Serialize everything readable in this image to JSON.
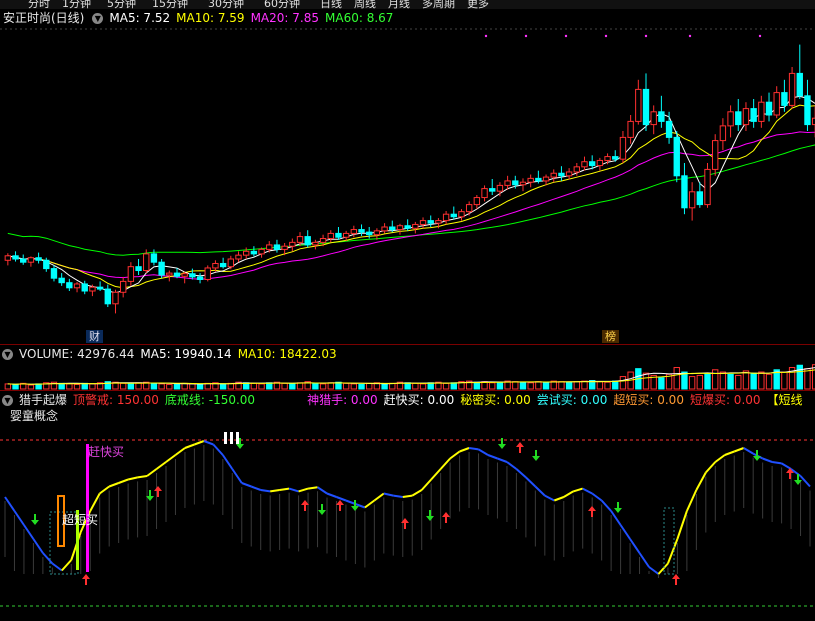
{
  "topbar": {
    "items": [
      "分时",
      "1分钟",
      "5分钟",
      "15分钟",
      "30分钟",
      "60分钟",
      "日线",
      "周线",
      "月线",
      "多周期",
      "更多"
    ]
  },
  "main_header": {
    "title": "安正时尚(日线)",
    "ma5": "MA5: 7.52",
    "ma10": "MA10: 7.59",
    "ma20": "MA20: 7.85",
    "ma60": "MA60: 8.67"
  },
  "main_markers": {
    "cai": "财",
    "bang": "榜"
  },
  "volume_header": {
    "title": "VOLUME: 42976.44",
    "ma5": "MA5: 19940.14",
    "ma10": "MA10: 18422.03"
  },
  "indicator_header": {
    "name": "猎手起爆",
    "top_warn": "顶警戒: 150.00",
    "bottom_warn": "底戒线: -150.00",
    "hunter": "神猎手: 0.00",
    "quick_buy": "赶快买: 0.00",
    "secret_buy": "秘密买: 0.00",
    "try_buy": "尝试买: 0.00",
    "super_short": "超短买: 0.00",
    "short_burst": "短爆买: 0.00",
    "short_line": "【短线"
  },
  "indicator_sub": "婴童概念",
  "indicator_labels": {
    "quick_buy": "赶快买",
    "super_short": "超短买"
  },
  "colors": {
    "ma5": "#ffffff",
    "ma10": "#ffff00",
    "ma20": "#ff00ff",
    "ma60": "#00ff00",
    "up": "#ff3030",
    "down": "#00ffff",
    "curve_up": "#ffff00",
    "curve_down": "#2050ff"
  },
  "chart_data": [
    {
      "type": "candlestick",
      "title": "安正时尚(日线)",
      "ma_series": [
        {
          "name": "MA5",
          "value": 7.52
        },
        {
          "name": "MA10",
          "value": 7.59
        },
        {
          "name": "MA20",
          "value": 7.85
        },
        {
          "name": "MA60",
          "value": 8.67
        }
      ],
      "ohlc": [
        [
          7.38,
          7.49,
          7.3,
          7.45
        ],
        [
          7.45,
          7.52,
          7.36,
          7.4
        ],
        [
          7.4,
          7.47,
          7.31,
          7.35
        ],
        [
          7.35,
          7.44,
          7.28,
          7.42
        ],
        [
          7.42,
          7.5,
          7.33,
          7.38
        ],
        [
          7.38,
          7.42,
          7.2,
          7.25
        ],
        [
          7.25,
          7.3,
          7.05,
          7.1
        ],
        [
          7.1,
          7.18,
          6.98,
          7.03
        ],
        [
          7.03,
          7.09,
          6.9,
          6.95
        ],
        [
          6.95,
          7.04,
          6.88,
          7.01
        ],
        [
          7.01,
          7.06,
          6.85,
          6.9
        ],
        [
          6.9,
          7.0,
          6.82,
          6.96
        ],
        [
          6.96,
          7.05,
          6.9,
          6.93
        ],
        [
          6.93,
          7.0,
          6.65,
          6.7
        ],
        [
          6.7,
          6.92,
          6.55,
          6.88
        ],
        [
          6.88,
          7.12,
          6.8,
          7.05
        ],
        [
          7.05,
          7.35,
          6.98,
          7.28
        ],
        [
          7.28,
          7.4,
          7.15,
          7.22
        ],
        [
          7.22,
          7.55,
          7.18,
          7.48
        ],
        [
          7.48,
          7.55,
          7.3,
          7.35
        ],
        [
          7.35,
          7.4,
          7.1,
          7.15
        ],
        [
          7.15,
          7.22,
          7.05,
          7.18
        ],
        [
          7.18,
          7.26,
          7.1,
          7.13
        ],
        [
          7.13,
          7.2,
          7.02,
          7.17
        ],
        [
          7.17,
          7.25,
          7.08,
          7.12
        ],
        [
          7.12,
          7.18,
          7.02,
          7.08
        ],
        [
          7.08,
          7.3,
          7.05,
          7.26
        ],
        [
          7.26,
          7.38,
          7.2,
          7.33
        ],
        [
          7.33,
          7.42,
          7.25,
          7.28
        ],
        [
          7.28,
          7.45,
          7.24,
          7.4
        ],
        [
          7.4,
          7.52,
          7.35,
          7.46
        ],
        [
          7.46,
          7.58,
          7.4,
          7.52
        ],
        [
          7.52,
          7.6,
          7.44,
          7.48
        ],
        [
          7.48,
          7.58,
          7.42,
          7.55
        ],
        [
          7.55,
          7.68,
          7.5,
          7.62
        ],
        [
          7.62,
          7.7,
          7.5,
          7.55
        ],
        [
          7.55,
          7.65,
          7.46,
          7.6
        ],
        [
          7.6,
          7.72,
          7.52,
          7.66
        ],
        [
          7.66,
          7.82,
          7.6,
          7.75
        ],
        [
          7.75,
          7.85,
          7.58,
          7.62
        ],
        [
          7.62,
          7.7,
          7.55,
          7.66
        ],
        [
          7.66,
          7.78,
          7.6,
          7.72
        ],
        [
          7.72,
          7.85,
          7.66,
          7.8
        ],
        [
          7.8,
          7.9,
          7.7,
          7.74
        ],
        [
          7.74,
          7.84,
          7.68,
          7.8
        ],
        [
          7.8,
          7.92,
          7.74,
          7.86
        ],
        [
          7.86,
          7.94,
          7.76,
          7.82
        ],
        [
          7.82,
          7.9,
          7.72,
          7.78
        ],
        [
          7.78,
          7.88,
          7.7,
          7.84
        ],
        [
          7.84,
          7.96,
          7.8,
          7.9
        ],
        [
          7.9,
          8.0,
          7.82,
          7.86
        ],
        [
          7.86,
          7.95,
          7.78,
          7.92
        ],
        [
          7.92,
          8.02,
          7.84,
          7.88
        ],
        [
          7.88,
          7.98,
          7.8,
          7.94
        ],
        [
          7.94,
          8.05,
          7.88,
          8.0
        ],
        [
          8.0,
          8.08,
          7.9,
          7.96
        ],
        [
          7.96,
          8.04,
          7.88,
          8.0
        ],
        [
          8.0,
          8.15,
          7.94,
          8.1
        ],
        [
          8.1,
          8.22,
          8.02,
          8.06
        ],
        [
          8.06,
          8.18,
          8.0,
          8.14
        ],
        [
          8.14,
          8.3,
          8.08,
          8.25
        ],
        [
          8.25,
          8.4,
          8.18,
          8.36
        ],
        [
          8.36,
          8.55,
          8.3,
          8.5
        ],
        [
          8.5,
          8.65,
          8.4,
          8.46
        ],
        [
          8.46,
          8.6,
          8.38,
          8.55
        ],
        [
          8.55,
          8.7,
          8.48,
          8.62
        ],
        [
          8.62,
          8.7,
          8.5,
          8.56
        ],
        [
          8.56,
          8.66,
          8.46,
          8.6
        ],
        [
          8.6,
          8.72,
          8.52,
          8.66
        ],
        [
          8.66,
          8.78,
          8.58,
          8.62
        ],
        [
          8.62,
          8.72,
          8.55,
          8.68
        ],
        [
          8.68,
          8.8,
          8.6,
          8.74
        ],
        [
          8.74,
          8.85,
          8.62,
          8.7
        ],
        [
          8.7,
          8.82,
          8.64,
          8.76
        ],
        [
          8.76,
          8.9,
          8.7,
          8.84
        ],
        [
          8.84,
          9.0,
          8.78,
          8.92
        ],
        [
          8.92,
          9.02,
          8.8,
          8.86
        ],
        [
          8.86,
          8.98,
          8.78,
          8.94
        ],
        [
          8.94,
          9.05,
          8.88,
          9.0
        ],
        [
          9.0,
          9.1,
          8.92,
          8.96
        ],
        [
          8.96,
          9.4,
          8.9,
          9.3
        ],
        [
          9.3,
          9.65,
          9.2,
          9.55
        ],
        [
          9.55,
          10.2,
          9.5,
          10.05
        ],
        [
          10.05,
          10.3,
          9.4,
          9.5
        ],
        [
          9.5,
          9.8,
          9.35,
          9.7
        ],
        [
          9.7,
          9.95,
          9.45,
          9.55
        ],
        [
          9.55,
          9.7,
          9.2,
          9.3
        ],
        [
          9.3,
          9.4,
          8.6,
          8.7
        ],
        [
          8.7,
          8.9,
          8.1,
          8.2
        ],
        [
          8.2,
          8.6,
          8.0,
          8.45
        ],
        [
          8.45,
          8.6,
          8.2,
          8.25
        ],
        [
          8.25,
          8.9,
          8.2,
          8.8
        ],
        [
          8.8,
          9.35,
          8.7,
          9.25
        ],
        [
          9.25,
          9.6,
          9.1,
          9.48
        ],
        [
          9.48,
          9.8,
          9.3,
          9.7
        ],
        [
          9.7,
          9.9,
          9.4,
          9.5
        ],
        [
          9.5,
          9.85,
          9.4,
          9.75
        ],
        [
          9.75,
          9.9,
          9.45,
          9.55
        ],
        [
          9.55,
          9.95,
          9.45,
          9.85
        ],
        [
          9.85,
          10.0,
          9.55,
          9.65
        ],
        [
          9.65,
          10.1,
          9.6,
          10.0
        ],
        [
          10.0,
          10.2,
          9.7,
          9.8
        ],
        [
          9.8,
          10.4,
          9.75,
          10.3
        ],
        [
          10.3,
          10.75,
          9.9,
          9.95
        ],
        [
          9.95,
          10.2,
          9.4,
          9.5
        ],
        [
          9.5,
          9.8,
          9.3,
          9.6
        ]
      ]
    },
    {
      "type": "bar",
      "title": "VOLUME: 42976.44",
      "series": [
        {
          "name": "VOLUME",
          "value": 42976.44
        },
        {
          "name": "MA5",
          "value": 19940.14
        },
        {
          "name": "MA10",
          "value": 18422.03
        }
      ],
      "values": [
        9,
        8,
        10,
        7,
        9,
        11,
        12,
        10,
        9,
        8,
        10,
        9,
        11,
        13,
        12,
        10,
        9,
        11,
        12,
        10,
        9,
        8,
        9,
        10,
        9,
        8,
        10,
        11,
        9,
        10,
        12,
        11,
        10,
        9,
        11,
        12,
        10,
        9,
        11,
        13,
        10,
        9,
        11,
        12,
        10,
        9,
        8,
        10,
        11,
        9,
        10,
        12,
        11,
        10,
        9,
        11,
        12,
        10,
        11,
        13,
        14,
        12,
        13,
        11,
        12,
        14,
        13,
        12,
        11,
        13,
        12,
        14,
        13,
        12,
        13,
        14,
        15,
        13,
        12,
        14,
        22,
        30,
        36,
        28,
        24,
        20,
        26,
        38,
        30,
        22,
        24,
        28,
        34,
        30,
        26,
        24,
        32,
        28,
        30,
        26,
        34,
        30,
        38,
        42,
        36,
        43
      ]
    },
    {
      "type": "line",
      "title": "猎手起爆",
      "series": [
        {
          "name": "顶警戒",
          "value": 150.0
        },
        {
          "name": "底戒线",
          "value": -150.0
        },
        {
          "name": "神猎手",
          "value": 0.0
        },
        {
          "name": "赶快买",
          "value": 0.0
        },
        {
          "name": "秘密买",
          "value": 0.0
        },
        {
          "name": "尝试买",
          "value": 0.0
        },
        {
          "name": "超短买",
          "value": 0.0
        },
        {
          "name": "短爆买",
          "value": 0.0
        }
      ],
      "curve": [
        0.1,
        -0.1,
        -0.3,
        -0.5,
        -0.7,
        -0.85,
        -0.95,
        -0.8,
        -0.4,
        -0.1,
        0.15,
        0.25,
        0.3,
        0.35,
        0.38,
        0.4,
        0.5,
        0.6,
        0.7,
        0.8,
        0.85,
        0.9,
        0.85,
        0.7,
        0.5,
        0.3,
        0.25,
        0.2,
        0.18,
        0.2,
        0.22,
        0.18,
        0.22,
        0.24,
        0.15,
        0.1,
        0.05,
        0.0,
        -0.05,
        0.05,
        0.15,
        0.12,
        0.1,
        0.12,
        0.2,
        0.35,
        0.5,
        0.65,
        0.75,
        0.8,
        0.78,
        0.7,
        0.65,
        0.6,
        0.5,
        0.38,
        0.25,
        0.12,
        0.05,
        0.1,
        0.18,
        0.22,
        0.15,
        0.05,
        -0.1,
        -0.3,
        -0.5,
        -0.7,
        -0.9,
        -1.0,
        -0.85,
        -0.5,
        -0.1,
        0.2,
        0.45,
        0.6,
        0.7,
        0.75,
        0.8,
        0.72,
        0.65,
        0.6,
        0.58,
        0.5,
        0.4,
        0.25
      ]
    }
  ]
}
